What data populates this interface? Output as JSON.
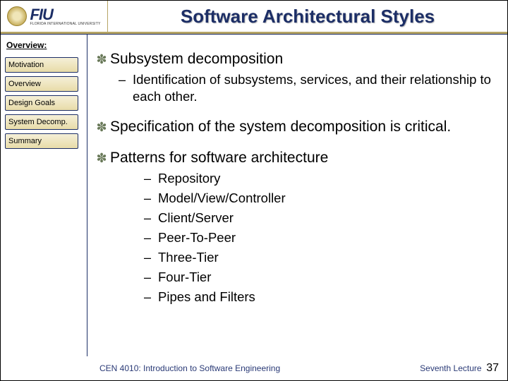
{
  "logo": {
    "big": "FIU",
    "small": "FLORIDA INTERNATIONAL UNIVERSITY"
  },
  "title": "Software Architectural Styles",
  "sidebar": {
    "heading": "Overview:",
    "items": [
      "Motivation",
      "Overview",
      "Design Goals",
      "System Decomp.",
      "Summary"
    ]
  },
  "bullets": [
    {
      "text": "Subsystem decomposition",
      "subs": [
        "Identification of subsystems, services, and their relationship to each other."
      ]
    },
    {
      "text": "Specification of the system decomposition is critical.",
      "subs": []
    },
    {
      "text": "Patterns for software architecture",
      "subs": [
        "Repository",
        "Model/View/Controller",
        "Client/Server",
        "Peer-To-Peer",
        "Three-Tier",
        "Four-Tier",
        "Pipes and Filters"
      ]
    }
  ],
  "footer": {
    "course": "CEN 4010: Introduction to Software Engineering",
    "lecture": "Seventh Lecture",
    "page": "37"
  }
}
